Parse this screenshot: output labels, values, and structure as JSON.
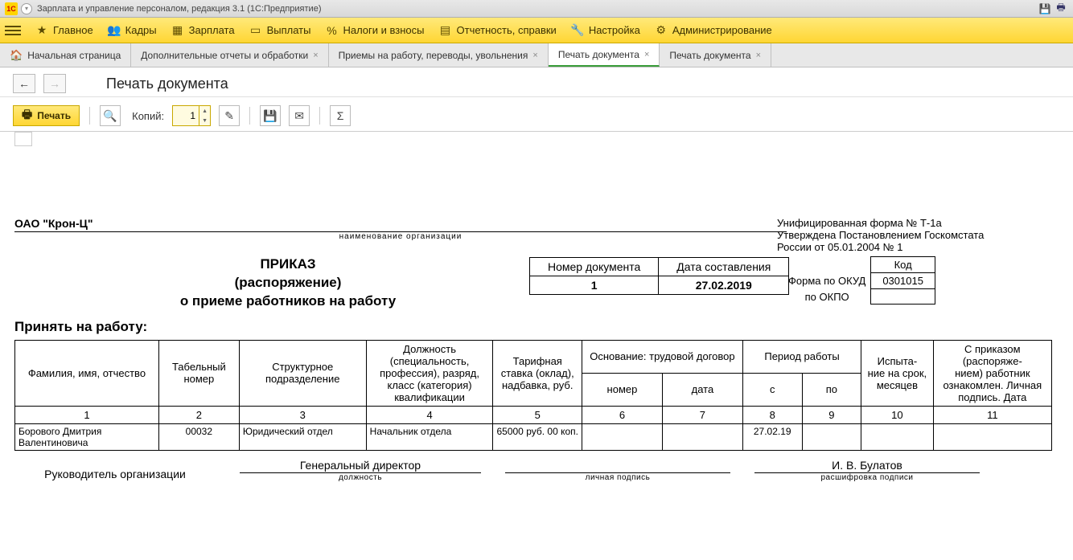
{
  "titlebar": {
    "title": "Зарплата и управление персоналом, редакция 3.1  (1С:Предприятие)"
  },
  "mainmenu": {
    "items": [
      "Главное",
      "Кадры",
      "Зарплата",
      "Выплаты",
      "Налоги и взносы",
      "Отчетность, справки",
      "Настройка",
      "Администрирование"
    ]
  },
  "tabs": [
    {
      "label": "Начальная страница",
      "closable": false,
      "home": true
    },
    {
      "label": "Дополнительные отчеты и обработки",
      "closable": true
    },
    {
      "label": "Приемы на работу, переводы, увольнения",
      "closable": true
    },
    {
      "label": "Печать документа",
      "closable": true,
      "active": true
    },
    {
      "label": "Печать документа",
      "closable": true
    }
  ],
  "page": {
    "title": "Печать документа"
  },
  "toolbar": {
    "print": "Печать",
    "copies_label": "Копий:",
    "copies_value": "1"
  },
  "form_info": {
    "line1": "Унифицированная форма № Т-1а",
    "line2": "Утверждена Постановлением Госкомстата",
    "line3": "России от 05.01.2004 № 1",
    "code_hdr": "Код",
    "okud_lbl": "Форма по ОКУД",
    "okud_val": "0301015",
    "okpo_lbl": "по ОКПО",
    "okpo_val": ""
  },
  "org": {
    "name": "ОАО \"Крон-Ц\"",
    "caption": "наименование организации"
  },
  "doc_hdr": {
    "prikaz": "ПРИКАЗ",
    "rasp": "(распоряжение)",
    "sub": "о приеме работников на работу",
    "num_lbl": "Номер документа",
    "num_val": "1",
    "date_lbl": "Дата составления",
    "date_val": "27.02.2019"
  },
  "accept": "Принять на работу:",
  "table": {
    "headers": {
      "fio": "Фамилия, имя, отчество",
      "tabnum": "Табельный номер",
      "dept": "Структурное подразделение",
      "pos": "Должность (специальность, профессия), разряд, класс (категория) квалификации",
      "rate": "Тарифная ставка (оклад), надбавка, руб.",
      "basis": "Основание: трудовой договор",
      "basis_num": "номер",
      "basis_date": "дата",
      "period": "Период работы",
      "period_from": "с",
      "period_to": "по",
      "trial": "Испыта-\nние на срок, месяцев",
      "sign": "С приказом (распоряже-\nнием) работник ознакомлен. Личная подпись. Дата"
    },
    "colnums": [
      "1",
      "2",
      "3",
      "4",
      "5",
      "6",
      "7",
      "8",
      "9",
      "10",
      "11"
    ],
    "row": {
      "fio": "Борового Дмитрия Валентиновича",
      "tabnum": "00032",
      "dept": "Юридический отдел",
      "pos": "Начальник отдела",
      "rate": "65000 руб. 00 коп.",
      "basis_num": "",
      "basis_date": "",
      "period_from": "27.02.19",
      "period_to": "",
      "trial": "",
      "sign": ""
    }
  },
  "signatures": {
    "lead_lbl": "Руководитель организации",
    "position": "Генеральный директор",
    "position_cap": "должность",
    "sign_cap": "личная подпись",
    "name": "И. В. Булатов",
    "name_cap": "расшифровка  подписи"
  }
}
